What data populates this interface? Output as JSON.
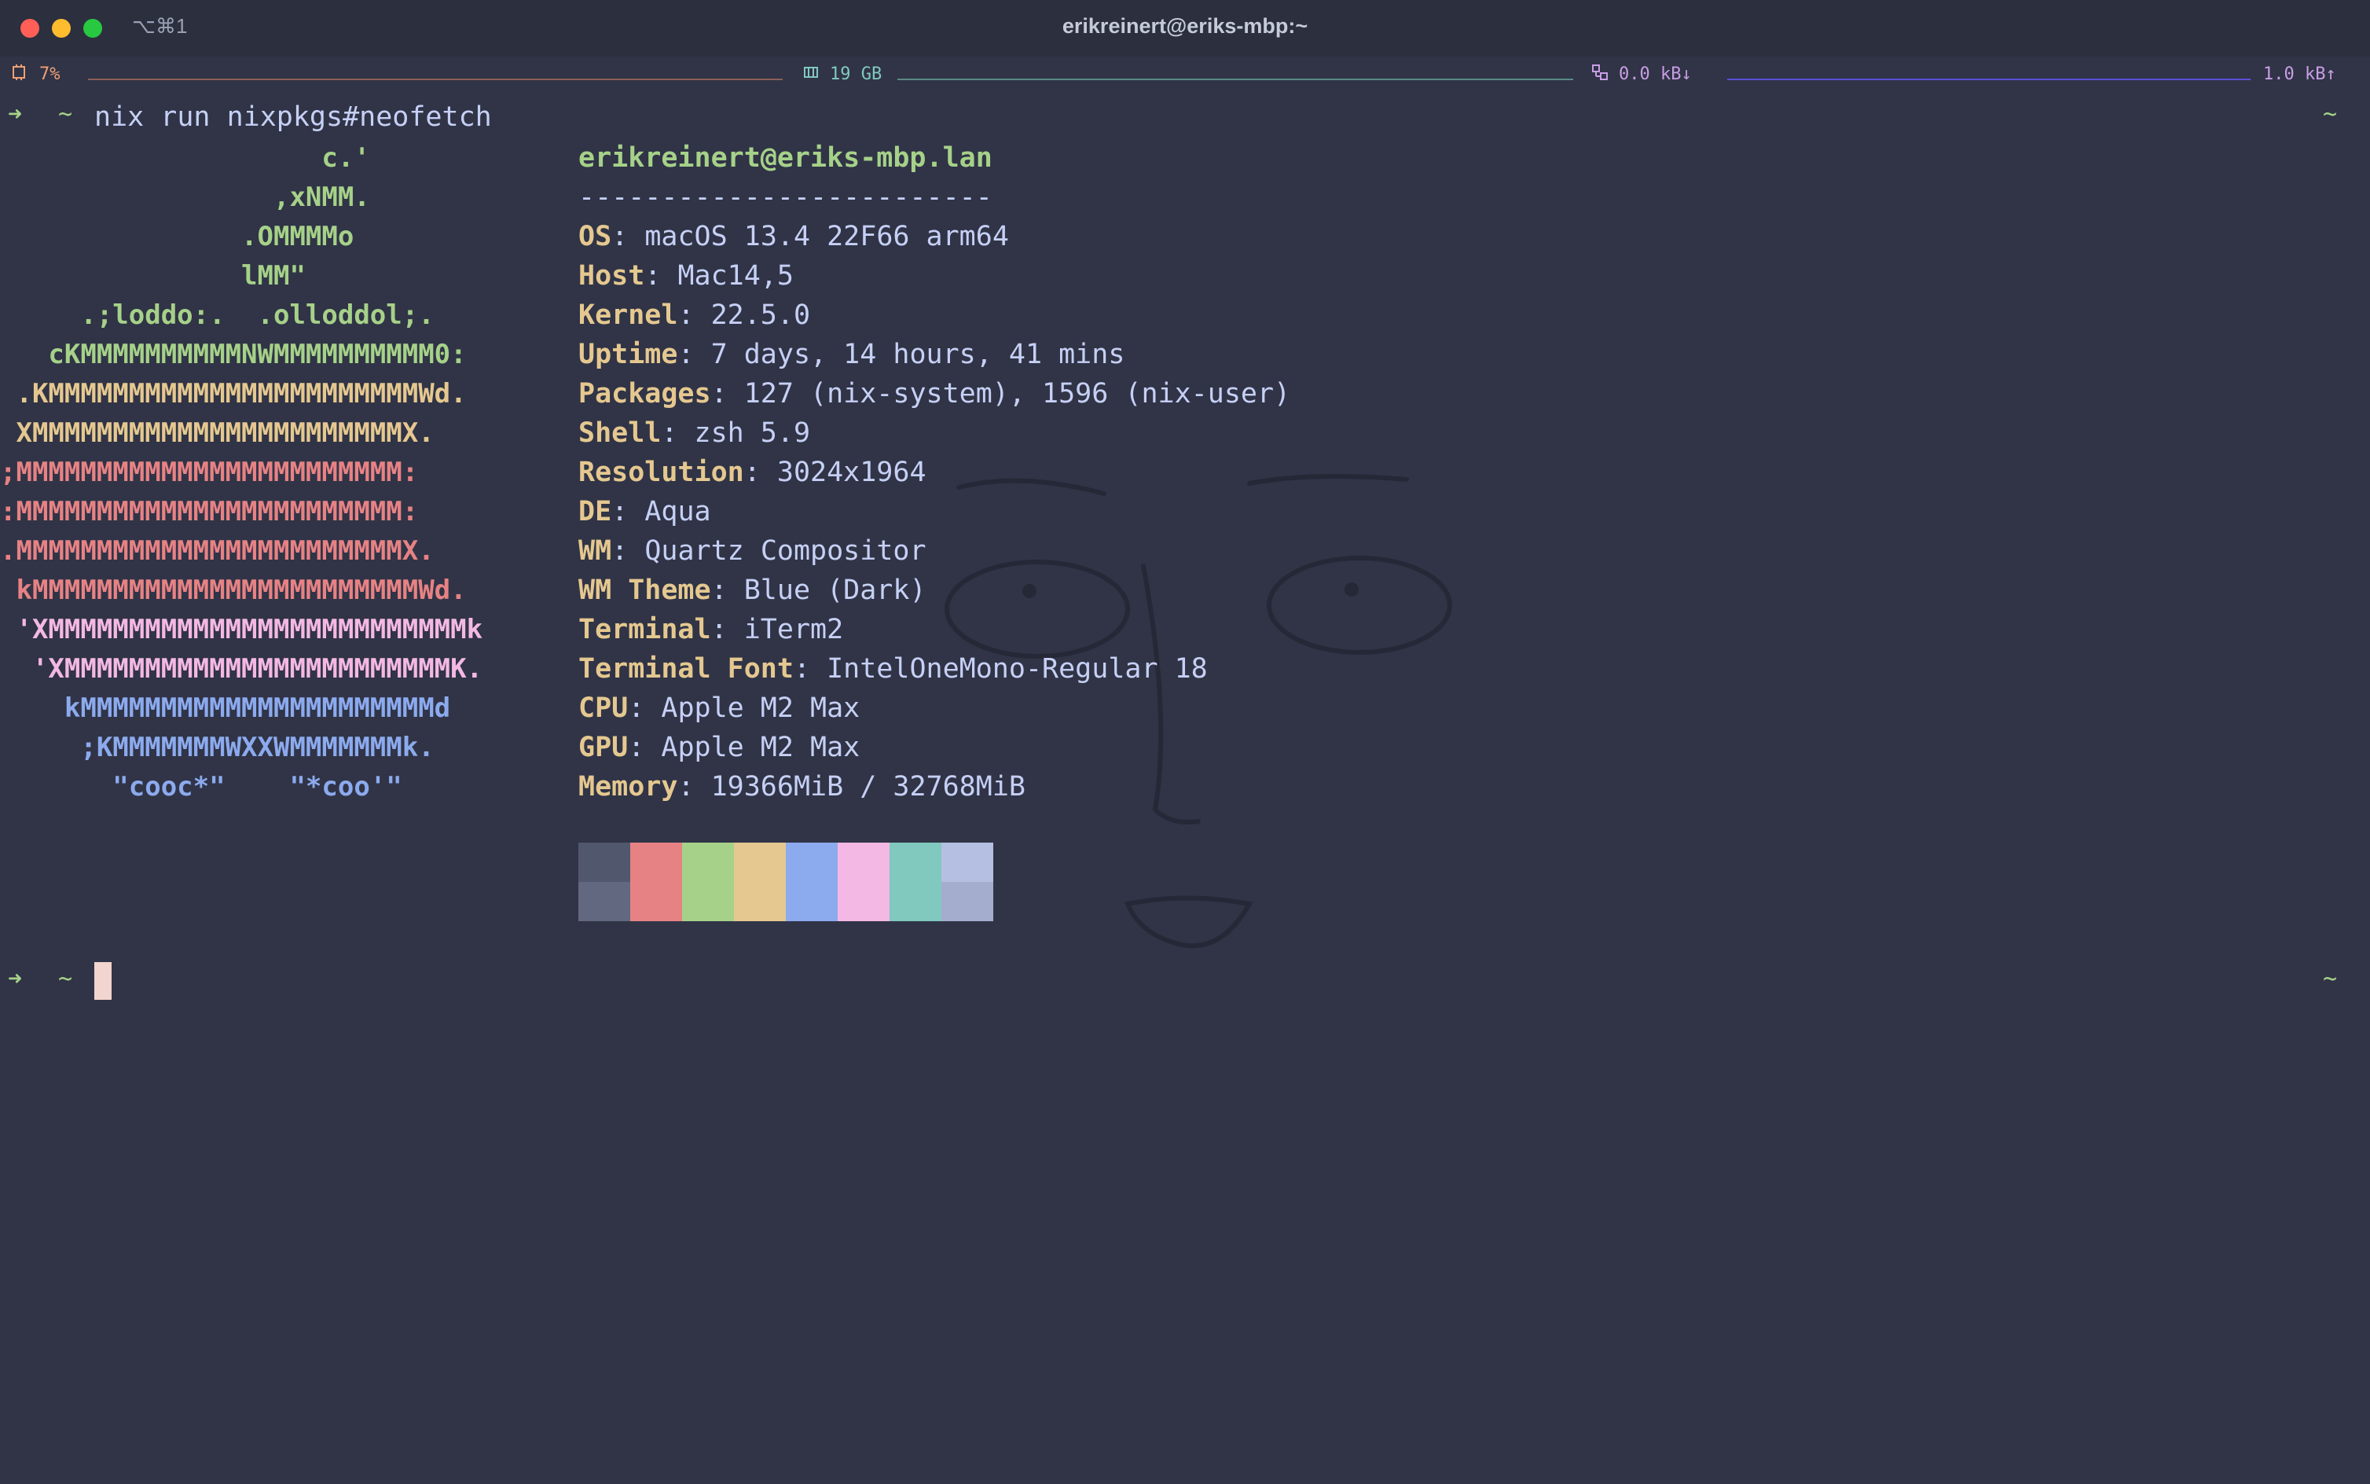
{
  "window": {
    "title": "erikreinert@eriks-mbp:~",
    "tab_shortcut": "⌥⌘1"
  },
  "statusbar": {
    "cpu": {
      "icon": "cpu-icon",
      "label": "7%",
      "color": "#ef9f76"
    },
    "memory": {
      "icon": "memory-icon",
      "label": "19 GB",
      "color": "#81c8be"
    },
    "network": {
      "icon": "network-icon",
      "down_label": "0.0 kB↓",
      "up_label": "1.0 kB↑",
      "color": "#ca9ee6",
      "line_color": "#5b4fd6"
    }
  },
  "terminal": {
    "prompt_symbol": "➜",
    "cwd": "~",
    "command": "nix run nixpkgs#neofetch",
    "right_prompt": "~"
  },
  "neofetch": {
    "logo": [
      {
        "text": "                    c.'",
        "color": "#a6d189"
      },
      {
        "text": "                 ,xNMM.",
        "color": "#a6d189"
      },
      {
        "text": "               .OMMMMo",
        "color": "#a6d189"
      },
      {
        "text": "               lMM\"",
        "color": "#a6d189"
      },
      {
        "text": "     .;loddo:.  .olloddol;.",
        "color": "#a6d189"
      },
      {
        "text": "   cKMMMMMMMMMMNWMMMMMMMMMM0:",
        "color": "#a6d189"
      },
      {
        "text": " .KMMMMMMMMMMMMMMMMMMMMMMMWd.",
        "color": "#e5c890"
      },
      {
        "text": " XMMMMMMMMMMMMMMMMMMMMMMMX.",
        "color": "#e5c890"
      },
      {
        "text": ";MMMMMMMMMMMMMMMMMMMMMMMM:",
        "color": "#e78284"
      },
      {
        "text": ":MMMMMMMMMMMMMMMMMMMMMMMM:",
        "color": "#e78284"
      },
      {
        "text": ".MMMMMMMMMMMMMMMMMMMMMMMMX.",
        "color": "#e78284"
      },
      {
        "text": " kMMMMMMMMMMMMMMMMMMMMMMMMWd.",
        "color": "#e78284"
      },
      {
        "text": " 'XMMMMMMMMMMMMMMMMMMMMMMMMMMk",
        "color": "#f4b8e4"
      },
      {
        "text": "  'XMMMMMMMMMMMMMMMMMMMMMMMMK.",
        "color": "#f4b8e4"
      },
      {
        "text": "    kMMMMMMMMMMMMMMMMMMMMMMd",
        "color": "#8caaee"
      },
      {
        "text": "     ;KMMMMMMMWXXWMMMMMMMk.",
        "color": "#8caaee"
      },
      {
        "text": "       \"cooc*\"    \"*coo'\"",
        "color": "#8caaee"
      }
    ],
    "header": "erikreinert@eriks-mbp.lan",
    "separator": "-------------------------",
    "info": [
      {
        "key": "OS",
        "value": "macOS 13.4 22F66 arm64"
      },
      {
        "key": "Host",
        "value": "Mac14,5"
      },
      {
        "key": "Kernel",
        "value": "22.5.0"
      },
      {
        "key": "Uptime",
        "value": "7 days, 14 hours, 41 mins"
      },
      {
        "key": "Packages",
        "value": "127 (nix-system), 1596 (nix-user)"
      },
      {
        "key": "Shell",
        "value": "zsh 5.9"
      },
      {
        "key": "Resolution",
        "value": "3024x1964"
      },
      {
        "key": "DE",
        "value": "Aqua"
      },
      {
        "key": "WM",
        "value": "Quartz Compositor"
      },
      {
        "key": "WM Theme",
        "value": "Blue (Dark)"
      },
      {
        "key": "Terminal",
        "value": "iTerm2"
      },
      {
        "key": "Terminal Font",
        "value": "IntelOneMono-Regular 18"
      },
      {
        "key": "CPU",
        "value": "Apple M2 Max"
      },
      {
        "key": "GPU",
        "value": "Apple M2 Max"
      },
      {
        "key": "Memory",
        "value": "19366MiB / 32768MiB"
      }
    ],
    "palette_top": [
      "#51576d",
      "#e78284",
      "#a6d189",
      "#e5c890",
      "#8caaee",
      "#f4b8e4",
      "#81c8be",
      "#b5bfe2"
    ],
    "palette_bottom": [
      "#626880",
      "#e78284",
      "#a6d189",
      "#e5c890",
      "#8caaee",
      "#f4b8e4",
      "#81c8be",
      "#a5adce"
    ]
  },
  "second_prompt": {
    "prompt_symbol": "➜",
    "cwd": "~",
    "right_prompt": "~"
  },
  "colors": {
    "background": "#303446",
    "text": "#c6d0f5",
    "key": "#e5c890",
    "prompt": "#a6d189",
    "cursor": "#f2d5cf"
  }
}
